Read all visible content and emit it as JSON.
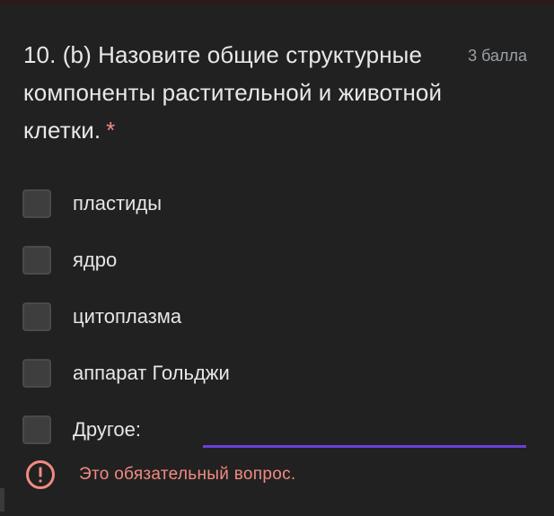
{
  "question": {
    "title": "10. (b) Назовите общие структурные компоненты растительной и животной клетки.",
    "required_marker": "*",
    "points": "3 балла"
  },
  "options": [
    {
      "label": "пластиды",
      "checked": false
    },
    {
      "label": "ядро",
      "checked": false
    },
    {
      "label": "цитоплазма",
      "checked": false
    },
    {
      "label": "аппарат Гольджи",
      "checked": false
    },
    {
      "label": "Другое:",
      "checked": false
    }
  ],
  "other_input": {
    "value": ""
  },
  "error": {
    "icon": "error-circle-icon",
    "text": "Это обязательный вопрос."
  },
  "colors": {
    "accent": "#6a3fd8",
    "error": "#f28b82",
    "background": "#212121",
    "text": "#e8e8e8"
  }
}
